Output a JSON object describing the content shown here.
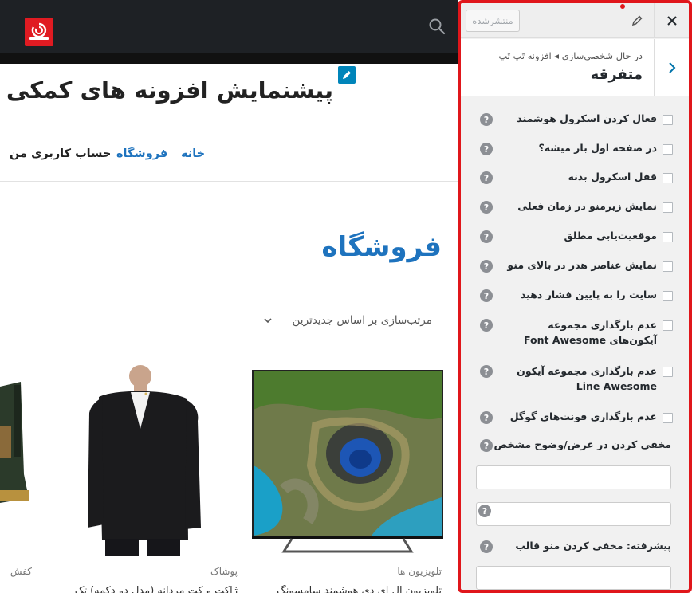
{
  "preview": {
    "site_title": "پیشنمایش افزونه های کمکی سایت",
    "nav": {
      "home": "خانه",
      "shop": "فروشگاه",
      "account": "حساب کاربری من"
    },
    "shop_title": "فروشگاه",
    "sort_label": "مرتب‌سازی بر اساس جدیدترین",
    "products": [
      {
        "category": "تلویزیون ها",
        "name": "تلویزیون ال ای دی هوشمند سامسونگ"
      },
      {
        "category": "پوشاک",
        "name": "ژاکت و کت مردانه (مدل دو دکمه) تک"
      },
      {
        "category": "کفش",
        "name": ""
      }
    ],
    "colors": {
      "accent": "#1e73be",
      "topbar": "#1e2125",
      "logo": "#e01b22"
    }
  },
  "panel": {
    "publish_label": "منتشرشده",
    "breadcrumb": "در حال شخصی‌سازی ◂ افزونه تَپ تَپ",
    "section_title": "متفرقه",
    "help_glyph": "?",
    "options": [
      {
        "label": "فعال کردن اسکرول هوشمند"
      },
      {
        "label": "در صفحه اول باز میشه؟"
      },
      {
        "label": "قفل اسکرول بدنه"
      },
      {
        "label": "نمایش زیرمنو در زمان فعلی"
      },
      {
        "label": "موقعیت‌یابی مطلق"
      },
      {
        "label": "نمایش عناصر هدر در بالای منو"
      },
      {
        "label": "سایت را به پایین فشار دهید"
      },
      {
        "label": "عدم بارگذاری مجموعه آیکون‌های Font Awesome"
      },
      {
        "label": "عدم بارگذاری مجموعه آیکون Line Awesome"
      },
      {
        "label": "عدم بارگذاری فونت‌های گوگل"
      }
    ],
    "blur_label": "مخفی کردن در عرض/وضوح مشخص",
    "advanced_label": "پیشرفته: مخفی کردن منو قالب",
    "border_color": "#e0161b"
  }
}
